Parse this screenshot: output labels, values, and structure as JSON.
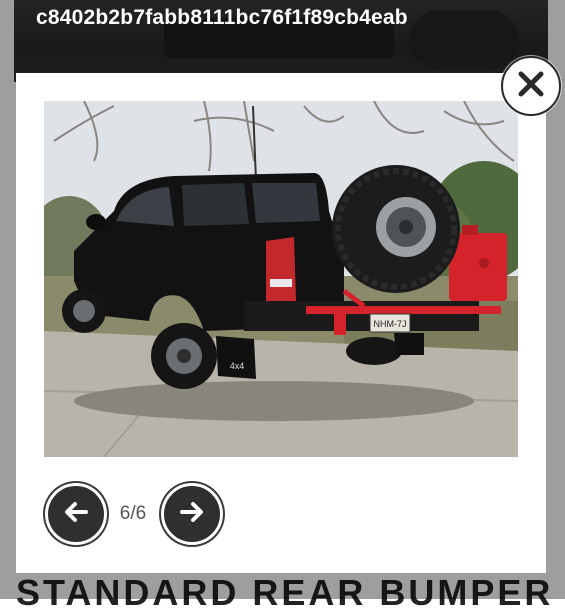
{
  "lightbox": {
    "title": "c8402b2b7fabb8111bc76f1f89cb4eab",
    "counter": "6/6",
    "photo": {
      "alt": "Black pickup truck with rear bumper, spare tire carrier, red jerry can and high-lift jack",
      "plate": "NHM-7J",
      "badge": "4x4"
    }
  },
  "background": {
    "heading": "STANDARD REAR BUMPER"
  },
  "icons": {
    "close": "close-icon",
    "prev": "arrow-left-icon",
    "next": "arrow-right-icon"
  },
  "colors": {
    "accent_red": "#d5232b",
    "truck_black": "#111111"
  }
}
